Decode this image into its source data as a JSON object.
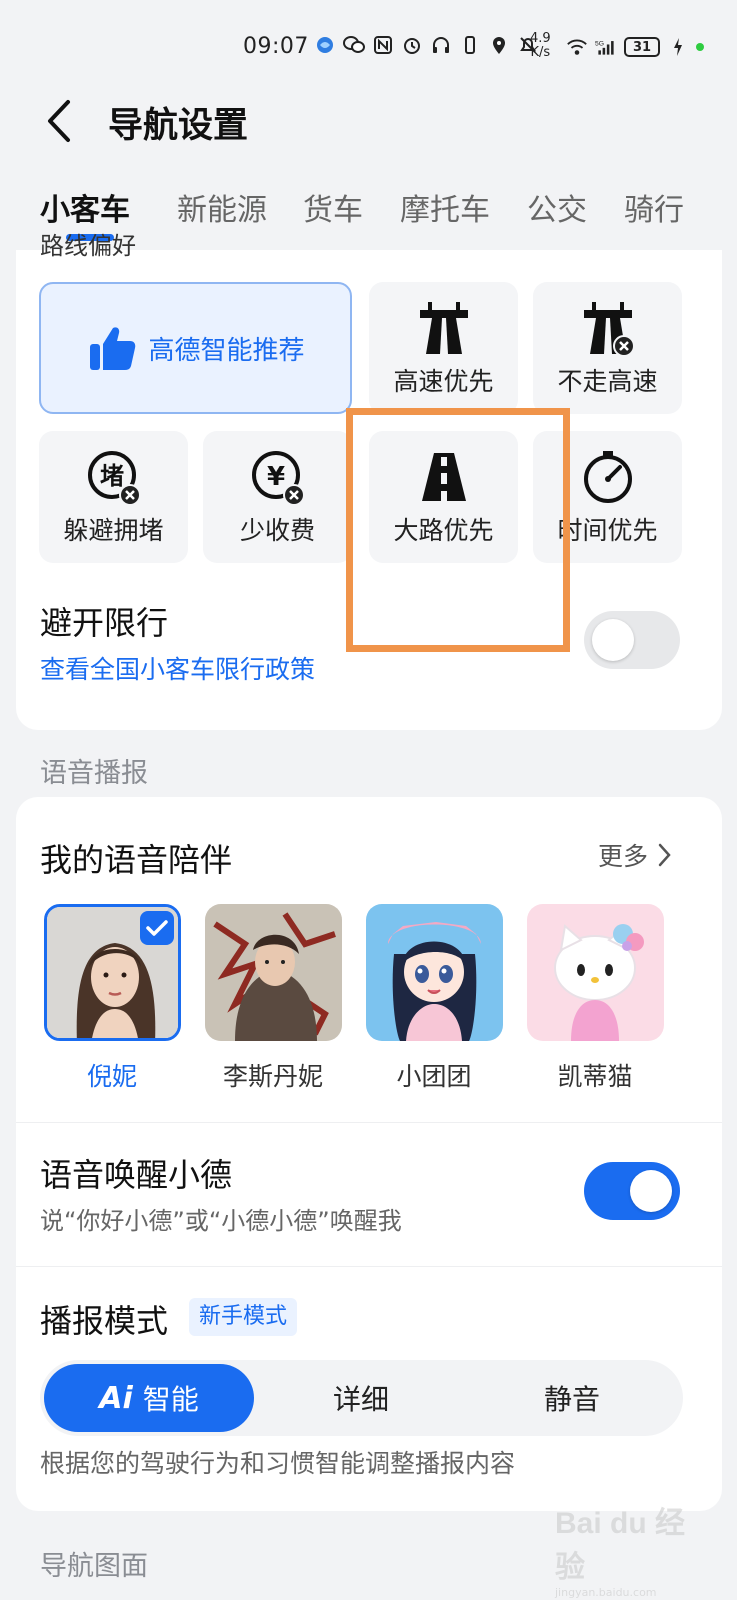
{
  "status_bar": {
    "time": "09:07",
    "net_speed_value": "4.9",
    "net_speed_unit": "K/s",
    "battery": "31",
    "icons": [
      "browser-icon",
      "wechat-icon",
      "nfc-icon",
      "alarm-icon",
      "headphones-icon",
      "vibrate-icon",
      "location-icon",
      "mute-icon",
      "wifi-icon",
      "signal-5g-icon",
      "charging-icon"
    ]
  },
  "header": {
    "title": "导航设置"
  },
  "tabs": [
    "小客车",
    "新能源",
    "货车",
    "摩托车",
    "公交",
    "骑行"
  ],
  "route": {
    "cut_label": "路线偏好",
    "options": [
      {
        "label": "高德智能推荐",
        "icon": "thumbs-up-icon",
        "selected": true
      },
      {
        "label": "高速优先",
        "icon": "highway-icon"
      },
      {
        "label": "不走高速",
        "icon": "no-highway-icon"
      },
      {
        "label": "躲避拥堵",
        "icon": "avoid-congestion-icon"
      },
      {
        "label": "少收费",
        "icon": "less-toll-icon"
      },
      {
        "label": "大路优先",
        "icon": "main-road-icon"
      },
      {
        "label": "时间优先",
        "icon": "stopwatch-icon"
      }
    ],
    "restriction": {
      "title": "避开限行",
      "link": "查看全国小客车限行政策",
      "enabled": false
    }
  },
  "voice_section": {
    "label": "语音播报",
    "companion_title": "我的语音陪伴",
    "more": "更多",
    "voices": [
      {
        "name": "倪妮",
        "selected": true
      },
      {
        "name": "李斯丹妮",
        "selected": false
      },
      {
        "name": "小团团",
        "selected": false
      },
      {
        "name": "凯蒂猫",
        "selected": false
      }
    ],
    "wake": {
      "title": "语音唤醒小德",
      "desc": "说“你好小德”或“小德小德”唤醒我",
      "enabled": true
    },
    "mode": {
      "title": "播报模式",
      "tag": "新手模式",
      "options": [
        "智能",
        "详细",
        "静音"
      ],
      "ai_badge": "Ai",
      "active": "智能",
      "desc": "根据您的驾驶行为和习惯智能调整播报内容"
    }
  },
  "bottom_section_label": "导航图面",
  "watermark": {
    "text": "Bai du 经验",
    "sub": "jingyan.baidu.com"
  },
  "colors": {
    "accent": "#1a6cf0",
    "highlight": "#f0944a",
    "background": "#f2f3f5"
  }
}
